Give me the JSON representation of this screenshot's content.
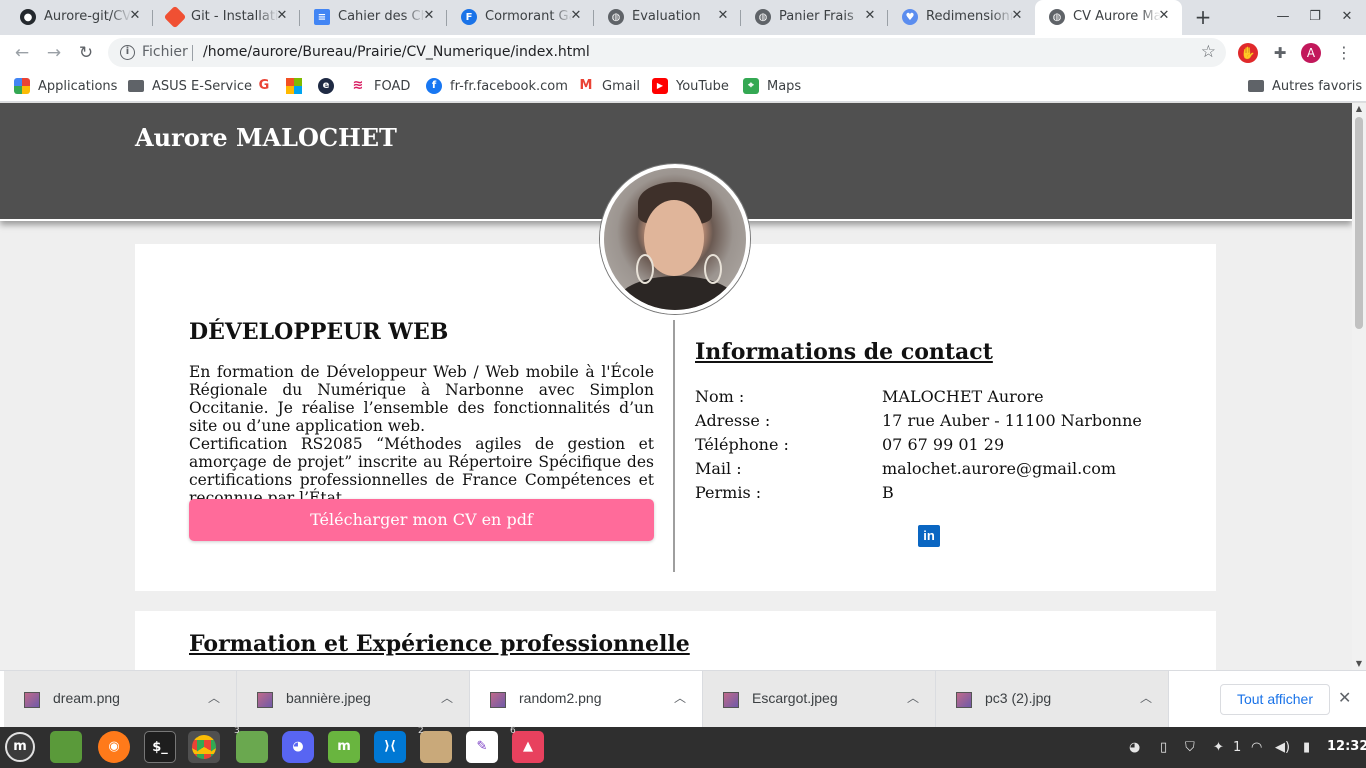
{
  "browser": {
    "tabs": [
      {
        "title": "Aurore-git/CV",
        "icon": "github-icon"
      },
      {
        "title": "Git - Installation",
        "icon": "git-icon"
      },
      {
        "title": "Cahier des Charges",
        "icon": "docs-icon"
      },
      {
        "title": "Cormorant Garamond",
        "icon": "fonts-icon"
      },
      {
        "title": "Évaluation",
        "icon": "globe-icon"
      },
      {
        "title": "Panier Frais",
        "icon": "globe-icon"
      },
      {
        "title": "Redimensionner",
        "icon": "heart-icon"
      },
      {
        "title": "CV Aurore Malochet",
        "icon": "globe-icon"
      }
    ],
    "new_tab": "+",
    "address": {
      "scheme": "Fichier",
      "url": "/home/aurore/Bureau/Prairie/CV_Numerique/index.html"
    },
    "profile_initial": "A",
    "bookmarks": [
      {
        "label": "Applications",
        "icon": "apps-grid-icon"
      },
      {
        "label": "ASUS E-Service",
        "icon": "folder-icon"
      },
      {
        "label": "",
        "icon": "google-icon"
      },
      {
        "label": "",
        "icon": "microsoft-icon"
      },
      {
        "label": "",
        "icon": "e-icon"
      },
      {
        "label": "FOAD",
        "icon": "foad-icon"
      },
      {
        "label": "fr-fr.facebook.com",
        "icon": "facebook-icon"
      },
      {
        "label": "Gmail",
        "icon": "gmail-icon"
      },
      {
        "label": "YouTube",
        "icon": "youtube-icon"
      },
      {
        "label": "Maps",
        "icon": "maps-icon"
      }
    ],
    "other_bookmarks": "Autres favoris"
  },
  "page": {
    "name": "Aurore MALOCHET",
    "job_title": "DÉVELOPPEUR WEB",
    "intro_1": "En formation de Développeur Web / Web mobile à l'École Régionale du Numérique à Narbonne avec Simplon Occitanie. Je réalise l’ensemble des fonctionnalités d’un site ou d’une application web.",
    "intro_2": "Certification RS2085 “Méthodes agiles de gestion et amorçage de projet” inscrite au Répertoire Spécifique des certifications professionnelles de France Compétences et reconnue par l’État.",
    "cv_button": "Télécharger mon CV en pdf",
    "contact": {
      "title": "Informations de contact",
      "rows": [
        {
          "label": "Nom :",
          "value": "MALOCHET Aurore"
        },
        {
          "label": "Adresse :",
          "value": "17 rue Auber - 11100 Narbonne"
        },
        {
          "label": "Téléphone :",
          "value": "07 67 99 01 29"
        },
        {
          "label": "Mail :",
          "value": "malochet.aurore@gmail.com"
        },
        {
          "label": "Permis :",
          "value": "B"
        }
      ],
      "linkedin_label": "in"
    },
    "formation_title": "Formation et Expérience professionnelle"
  },
  "downloads": {
    "items": [
      "dream.png",
      "bannière.jpeg",
      "random2.png",
      "Escargot.jpeg",
      "pc3 (2).jpg"
    ],
    "show_all": "Tout afficher"
  },
  "taskbar": {
    "tray": {
      "workspace": "1",
      "clock": "12:32"
    }
  },
  "colors": {
    "header": "#505050",
    "button": "#ff6b9a",
    "linkedin": "#0a66c2"
  }
}
